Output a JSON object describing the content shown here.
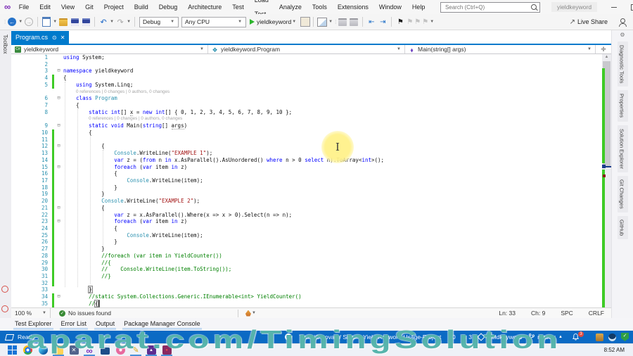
{
  "colors": {
    "accent": "#007acc",
    "status_blue": "#0b6ac4",
    "change_green": "#3ecb26",
    "keyword": "#0000ff",
    "type": "#2b91af",
    "string": "#a31515",
    "comment": "#008000"
  },
  "title_bar": {
    "menus": [
      "File",
      "Edit",
      "View",
      "Git",
      "Project",
      "Build",
      "Debug",
      "Architecture",
      "Test",
      "Load Test",
      "Analyze",
      "Tools",
      "Extensions",
      "Window",
      "Help"
    ],
    "search_placeholder": "Search (Ctrl+Q)",
    "account_label": "yieldkeyword"
  },
  "toolbar": {
    "debug": "Debug",
    "platform": "Any CPU",
    "run_label": "yieldkeyword",
    "live_share": "Live Share"
  },
  "left_panel": {
    "label": "Toolbox"
  },
  "right_panel": {
    "tabs": [
      "Diagnostic Tools",
      "Properties",
      "Solution Explorer",
      "Git Changes",
      "GitHub"
    ]
  },
  "editor": {
    "tab": "Program.cs",
    "breadcrumbs": [
      "yieldkeyword",
      "yieldkeyword.Program",
      "Main(string[] args)"
    ],
    "codelens": "0 references | 0 changes | 0 authors, 0 changes",
    "zoom": "100 %",
    "issues": "No issues found",
    "ln": "Ln: 33",
    "ch": "Ch: 9",
    "spc": "SPC",
    "eol": "CRLF"
  },
  "code": {
    "rows": [
      {
        "n": 1,
        "k": [
          [
            "k",
            "using"
          ],
          [
            "p",
            " System;"
          ]
        ]
      },
      {
        "n": 2,
        "k": []
      },
      {
        "n": 3,
        "f": 1,
        "k": [
          [
            "k",
            "namespace"
          ],
          [
            "p",
            " yieldkeyword"
          ]
        ]
      },
      {
        "n": 4,
        "g": 1,
        "k": [
          [
            "p",
            "{"
          ]
        ]
      },
      {
        "n": 5,
        "g": 1,
        "k": [
          [
            "p",
            "    "
          ],
          [
            "k",
            "using"
          ],
          [
            "p",
            " System.Linq;"
          ]
        ]
      },
      {
        "t": "cl",
        "ind": 4
      },
      {
        "n": 6,
        "f": 1,
        "k": [
          [
            "p",
            "    "
          ],
          [
            "k",
            "class"
          ],
          [
            "p",
            " "
          ],
          [
            "t",
            "Program"
          ]
        ]
      },
      {
        "n": 7,
        "k": [
          [
            "p",
            "    {"
          ]
        ]
      },
      {
        "n": 8,
        "k": [
          [
            "p",
            "        "
          ],
          [
            "k",
            "static"
          ],
          [
            "p",
            " "
          ],
          [
            "k",
            "int"
          ],
          [
            "p",
            "[] "
          ],
          [
            "u",
            "x"
          ],
          [
            "p",
            " = "
          ],
          [
            "k",
            "new"
          ],
          [
            "p",
            " "
          ],
          [
            "k",
            "int"
          ],
          [
            "p",
            "[] { 0, 1, 2, 3, 4, 5, 6, 7, 8, 9, 10 };"
          ]
        ]
      },
      {
        "t": "cl",
        "ind": 8
      },
      {
        "n": 9,
        "f": 1,
        "k": [
          [
            "p",
            "        "
          ],
          [
            "k",
            "static"
          ],
          [
            "p",
            " "
          ],
          [
            "k",
            "void"
          ],
          [
            "p",
            " Main("
          ],
          [
            "k",
            "string"
          ],
          [
            "p",
            "[] "
          ],
          [
            "u",
            "args"
          ],
          [
            "p",
            ")"
          ]
        ]
      },
      {
        "n": 10,
        "g": 1,
        "k": [
          [
            "p",
            "        {"
          ]
        ]
      },
      {
        "n": 11,
        "g": 1,
        "k": []
      },
      {
        "n": 12,
        "g": 1,
        "f": 1,
        "k": [
          [
            "p",
            "            {"
          ]
        ]
      },
      {
        "n": 13,
        "g": 1,
        "k": [
          [
            "p",
            "                "
          ],
          [
            "t",
            "Console"
          ],
          [
            "p",
            ".WriteLine("
          ],
          [
            "s",
            "\"EXAMPLE 1\""
          ],
          [
            "p",
            ");"
          ]
        ]
      },
      {
        "n": 14,
        "g": 1,
        "k": [
          [
            "p",
            "                "
          ],
          [
            "k",
            "var"
          ],
          [
            "p",
            " z = ("
          ],
          [
            "k",
            "from"
          ],
          [
            "p",
            " n "
          ],
          [
            "k",
            "in"
          ],
          [
            "p",
            " x.AsParallel().AsUnordered() "
          ],
          [
            "k",
            "where"
          ],
          [
            "p",
            " n > 0 "
          ],
          [
            "k",
            "select"
          ],
          [
            "p",
            " n).ToArray<"
          ],
          [
            "k",
            "int"
          ],
          [
            "p",
            ">();"
          ]
        ]
      },
      {
        "n": 15,
        "g": 1,
        "f": 1,
        "k": [
          [
            "p",
            "                "
          ],
          [
            "k",
            "foreach"
          ],
          [
            "p",
            " ("
          ],
          [
            "k",
            "var"
          ],
          [
            "p",
            " item "
          ],
          [
            "k",
            "in"
          ],
          [
            "p",
            " z)"
          ]
        ]
      },
      {
        "n": 16,
        "g": 1,
        "k": [
          [
            "p",
            "                {"
          ]
        ]
      },
      {
        "n": 17,
        "g": 1,
        "k": [
          [
            "p",
            "                    "
          ],
          [
            "t",
            "Console"
          ],
          [
            "p",
            ".WriteLine(item);"
          ]
        ]
      },
      {
        "n": 18,
        "g": 1,
        "k": [
          [
            "p",
            "                }"
          ]
        ]
      },
      {
        "n": 19,
        "g": 1,
        "k": [
          [
            "p",
            "            }"
          ]
        ]
      },
      {
        "n": 20,
        "g": 1,
        "k": [
          [
            "p",
            "            "
          ],
          [
            "t",
            "Console"
          ],
          [
            "p",
            ".WriteLine("
          ],
          [
            "s",
            "\"EXAMPLE 2\""
          ],
          [
            "p",
            ");"
          ]
        ]
      },
      {
        "n": 21,
        "g": 1,
        "f": 1,
        "k": [
          [
            "p",
            "            {"
          ]
        ]
      },
      {
        "n": 22,
        "g": 1,
        "k": [
          [
            "p",
            "                "
          ],
          [
            "k",
            "var"
          ],
          [
            "p",
            " z = x.AsParallel().Where(x => x > 0).Select(n => n);"
          ]
        ]
      },
      {
        "n": 23,
        "g": 1,
        "f": 1,
        "k": [
          [
            "p",
            "                "
          ],
          [
            "k",
            "foreach"
          ],
          [
            "p",
            " ("
          ],
          [
            "k",
            "var"
          ],
          [
            "p",
            " item "
          ],
          [
            "k",
            "in"
          ],
          [
            "p",
            " z)"
          ]
        ]
      },
      {
        "n": 24,
        "g": 1,
        "k": [
          [
            "p",
            "                {"
          ]
        ]
      },
      {
        "n": 25,
        "g": 1,
        "k": [
          [
            "p",
            "                    "
          ],
          [
            "t",
            "Console"
          ],
          [
            "p",
            ".WriteLine(item);"
          ]
        ]
      },
      {
        "n": 26,
        "g": 1,
        "k": [
          [
            "p",
            "                }"
          ]
        ]
      },
      {
        "n": 27,
        "g": 1,
        "k": [
          [
            "p",
            "            }"
          ]
        ]
      },
      {
        "n": 28,
        "g": 1,
        "k": [
          [
            "p",
            "            "
          ],
          [
            "c",
            "//foreach (var item in YieldCounter())"
          ]
        ]
      },
      {
        "n": 29,
        "g": 1,
        "k": [
          [
            "p",
            "            "
          ],
          [
            "c",
            "//{"
          ]
        ]
      },
      {
        "n": 30,
        "g": 1,
        "k": [
          [
            "p",
            "            "
          ],
          [
            "c",
            "//    Console.WriteLine(item.ToString());"
          ]
        ]
      },
      {
        "n": 31,
        "g": 1,
        "k": [
          [
            "p",
            "            "
          ],
          [
            "c",
            "//}"
          ]
        ]
      },
      {
        "n": 32,
        "g": 1,
        "k": []
      },
      {
        "n": 33,
        "k": [
          [
            "p",
            "        "
          ],
          [
            "b",
            "}"
          ]
        ]
      },
      {
        "n": 34,
        "g": 1,
        "f": 1,
        "k": [
          [
            "p",
            "        "
          ],
          [
            "c",
            "//static System.Collections.Generic.IEnumerable<int> YieldCounter()"
          ]
        ]
      },
      {
        "n": 35,
        "g": 1,
        "k": [
          [
            "p",
            "        "
          ],
          [
            "c",
            "//"
          ],
          [
            "x",
            "{"
          ]
        ]
      }
    ]
  },
  "bottom_tabs": [
    "Test Explorer",
    "Error List",
    "Output",
    "Package Manager Console"
  ],
  "status_bar": {
    "ready": "Ready",
    "repo": "TourajOstovari / Simple-Yield-Keyword-Usage-Project",
    "pushes": "0",
    "pending_edits": "3",
    "solution": "yieldkeyword",
    "branch": "master",
    "notifications": "3"
  },
  "taskbar": {
    "time": "8:52 AM",
    "icons": [
      {
        "name": "start",
        "art": "a-start",
        "active": false,
        "glyph": ""
      },
      {
        "name": "chrome",
        "art": "a-chrome",
        "active": false,
        "glyph": ""
      },
      {
        "name": "edge",
        "art": "a-edge",
        "active": false,
        "glyph": ""
      },
      {
        "name": "file-explorer",
        "art": "a-explorer",
        "active": true,
        "glyph": ""
      },
      {
        "name": "remote-tool",
        "art": "a-remote",
        "active": false,
        "glyph": "✕"
      },
      {
        "name": "visual-studio",
        "art": "a-vs",
        "active": true,
        "glyph": "∞"
      },
      {
        "name": "calculator",
        "art": "a-calc",
        "active": false,
        "glyph": ""
      },
      {
        "name": "paint-tool",
        "art": "a-pink",
        "active": false,
        "glyph": ""
      },
      {
        "name": "snip-pencil",
        "art": "a-pencil",
        "active": true,
        "glyph": "✎"
      },
      {
        "name": "photos",
        "art": "a-photos",
        "active": true,
        "glyph": "▲"
      },
      {
        "name": "media-project",
        "art": "a-project",
        "active": true,
        "glyph": "●"
      }
    ]
  },
  "watermark": "aparat.com/TimingSolution"
}
